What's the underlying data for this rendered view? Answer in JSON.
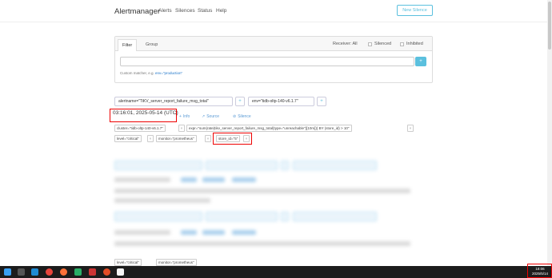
{
  "navbar": {
    "brand": "Alertmanager",
    "links": [
      "Alerts",
      "Silences",
      "Status",
      "Help"
    ],
    "new_silence": "New Silence"
  },
  "filter": {
    "tabs": [
      "Filter",
      "Group"
    ],
    "receiver_label": "Receiver: All",
    "silenced_label": "Silenced",
    "inhibited_label": "Inhibited",
    "input_value": "",
    "add_button": "+",
    "hint_text": "Custom matcher, e.g.",
    "hint_example": "env=\"production\""
  },
  "alert_group": {
    "group_labels": [
      "alertname=\"TiKV_server_report_failure_msg_total\"",
      "env=\"tidb-oltp-140-v6.1.7\""
    ],
    "plus": "+",
    "timestamp": "03:16:01, 2025-05-14 (UTC)",
    "actions": {
      "info": "Info",
      "source": "Source",
      "silence": "Silence"
    },
    "info_icon": "plus-icon",
    "source_icon": "chart-icon",
    "silence_icon": "mute-icon",
    "labels_row1": [
      "cluster=\"tidb-oltp-140-v6.1.7\"",
      "expr=\"sum(rate(tikv_server_report_failure_msg_total{type=\"unreachable\"}[10m])) BY (store_id) > 10\""
    ],
    "labels_row2": [
      "level=\"critical\"",
      "monitor=\"prometheus\"",
      "store_id=\"5\""
    ],
    "remove": "×"
  },
  "footer_partial": {
    "labels": [
      "level=\"critical\"",
      "monitor=\"prometheus\""
    ]
  },
  "taskbar": {
    "time": "18:06",
    "date": "2025/5/14"
  },
  "colors": {
    "accent": "#5bc0de",
    "highlight": "#e00000",
    "taskbar": "#1c1c1c"
  }
}
